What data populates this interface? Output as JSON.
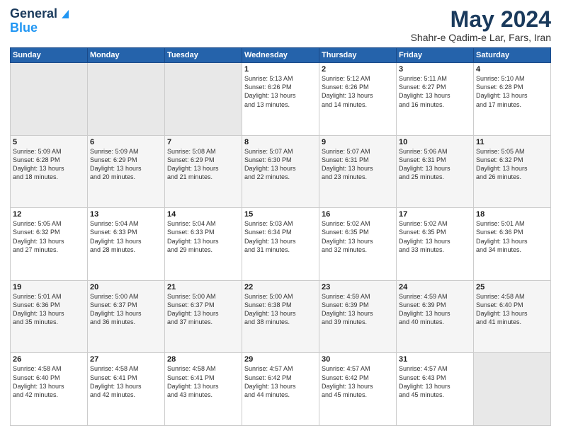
{
  "logo": {
    "line1": "General",
    "line2": "Blue"
  },
  "header": {
    "month": "May 2024",
    "location": "Shahr-e Qadim-e Lar, Fars, Iran"
  },
  "weekdays": [
    "Sunday",
    "Monday",
    "Tuesday",
    "Wednesday",
    "Thursday",
    "Friday",
    "Saturday"
  ],
  "weeks": [
    [
      {
        "day": "",
        "info": ""
      },
      {
        "day": "",
        "info": ""
      },
      {
        "day": "",
        "info": ""
      },
      {
        "day": "1",
        "info": "Sunrise: 5:13 AM\nSunset: 6:26 PM\nDaylight: 13 hours\nand 13 minutes."
      },
      {
        "day": "2",
        "info": "Sunrise: 5:12 AM\nSunset: 6:26 PM\nDaylight: 13 hours\nand 14 minutes."
      },
      {
        "day": "3",
        "info": "Sunrise: 5:11 AM\nSunset: 6:27 PM\nDaylight: 13 hours\nand 16 minutes."
      },
      {
        "day": "4",
        "info": "Sunrise: 5:10 AM\nSunset: 6:28 PM\nDaylight: 13 hours\nand 17 minutes."
      }
    ],
    [
      {
        "day": "5",
        "info": "Sunrise: 5:09 AM\nSunset: 6:28 PM\nDaylight: 13 hours\nand 18 minutes."
      },
      {
        "day": "6",
        "info": "Sunrise: 5:09 AM\nSunset: 6:29 PM\nDaylight: 13 hours\nand 20 minutes."
      },
      {
        "day": "7",
        "info": "Sunrise: 5:08 AM\nSunset: 6:29 PM\nDaylight: 13 hours\nand 21 minutes."
      },
      {
        "day": "8",
        "info": "Sunrise: 5:07 AM\nSunset: 6:30 PM\nDaylight: 13 hours\nand 22 minutes."
      },
      {
        "day": "9",
        "info": "Sunrise: 5:07 AM\nSunset: 6:31 PM\nDaylight: 13 hours\nand 23 minutes."
      },
      {
        "day": "10",
        "info": "Sunrise: 5:06 AM\nSunset: 6:31 PM\nDaylight: 13 hours\nand 25 minutes."
      },
      {
        "day": "11",
        "info": "Sunrise: 5:05 AM\nSunset: 6:32 PM\nDaylight: 13 hours\nand 26 minutes."
      }
    ],
    [
      {
        "day": "12",
        "info": "Sunrise: 5:05 AM\nSunset: 6:32 PM\nDaylight: 13 hours\nand 27 minutes."
      },
      {
        "day": "13",
        "info": "Sunrise: 5:04 AM\nSunset: 6:33 PM\nDaylight: 13 hours\nand 28 minutes."
      },
      {
        "day": "14",
        "info": "Sunrise: 5:04 AM\nSunset: 6:33 PM\nDaylight: 13 hours\nand 29 minutes."
      },
      {
        "day": "15",
        "info": "Sunrise: 5:03 AM\nSunset: 6:34 PM\nDaylight: 13 hours\nand 31 minutes."
      },
      {
        "day": "16",
        "info": "Sunrise: 5:02 AM\nSunset: 6:35 PM\nDaylight: 13 hours\nand 32 minutes."
      },
      {
        "day": "17",
        "info": "Sunrise: 5:02 AM\nSunset: 6:35 PM\nDaylight: 13 hours\nand 33 minutes."
      },
      {
        "day": "18",
        "info": "Sunrise: 5:01 AM\nSunset: 6:36 PM\nDaylight: 13 hours\nand 34 minutes."
      }
    ],
    [
      {
        "day": "19",
        "info": "Sunrise: 5:01 AM\nSunset: 6:36 PM\nDaylight: 13 hours\nand 35 minutes."
      },
      {
        "day": "20",
        "info": "Sunrise: 5:00 AM\nSunset: 6:37 PM\nDaylight: 13 hours\nand 36 minutes."
      },
      {
        "day": "21",
        "info": "Sunrise: 5:00 AM\nSunset: 6:37 PM\nDaylight: 13 hours\nand 37 minutes."
      },
      {
        "day": "22",
        "info": "Sunrise: 5:00 AM\nSunset: 6:38 PM\nDaylight: 13 hours\nand 38 minutes."
      },
      {
        "day": "23",
        "info": "Sunrise: 4:59 AM\nSunset: 6:39 PM\nDaylight: 13 hours\nand 39 minutes."
      },
      {
        "day": "24",
        "info": "Sunrise: 4:59 AM\nSunset: 6:39 PM\nDaylight: 13 hours\nand 40 minutes."
      },
      {
        "day": "25",
        "info": "Sunrise: 4:58 AM\nSunset: 6:40 PM\nDaylight: 13 hours\nand 41 minutes."
      }
    ],
    [
      {
        "day": "26",
        "info": "Sunrise: 4:58 AM\nSunset: 6:40 PM\nDaylight: 13 hours\nand 42 minutes."
      },
      {
        "day": "27",
        "info": "Sunrise: 4:58 AM\nSunset: 6:41 PM\nDaylight: 13 hours\nand 42 minutes."
      },
      {
        "day": "28",
        "info": "Sunrise: 4:58 AM\nSunset: 6:41 PM\nDaylight: 13 hours\nand 43 minutes."
      },
      {
        "day": "29",
        "info": "Sunrise: 4:57 AM\nSunset: 6:42 PM\nDaylight: 13 hours\nand 44 minutes."
      },
      {
        "day": "30",
        "info": "Sunrise: 4:57 AM\nSunset: 6:42 PM\nDaylight: 13 hours\nand 45 minutes."
      },
      {
        "day": "31",
        "info": "Sunrise: 4:57 AM\nSunset: 6:43 PM\nDaylight: 13 hours\nand 45 minutes."
      },
      {
        "day": "",
        "info": ""
      }
    ]
  ]
}
